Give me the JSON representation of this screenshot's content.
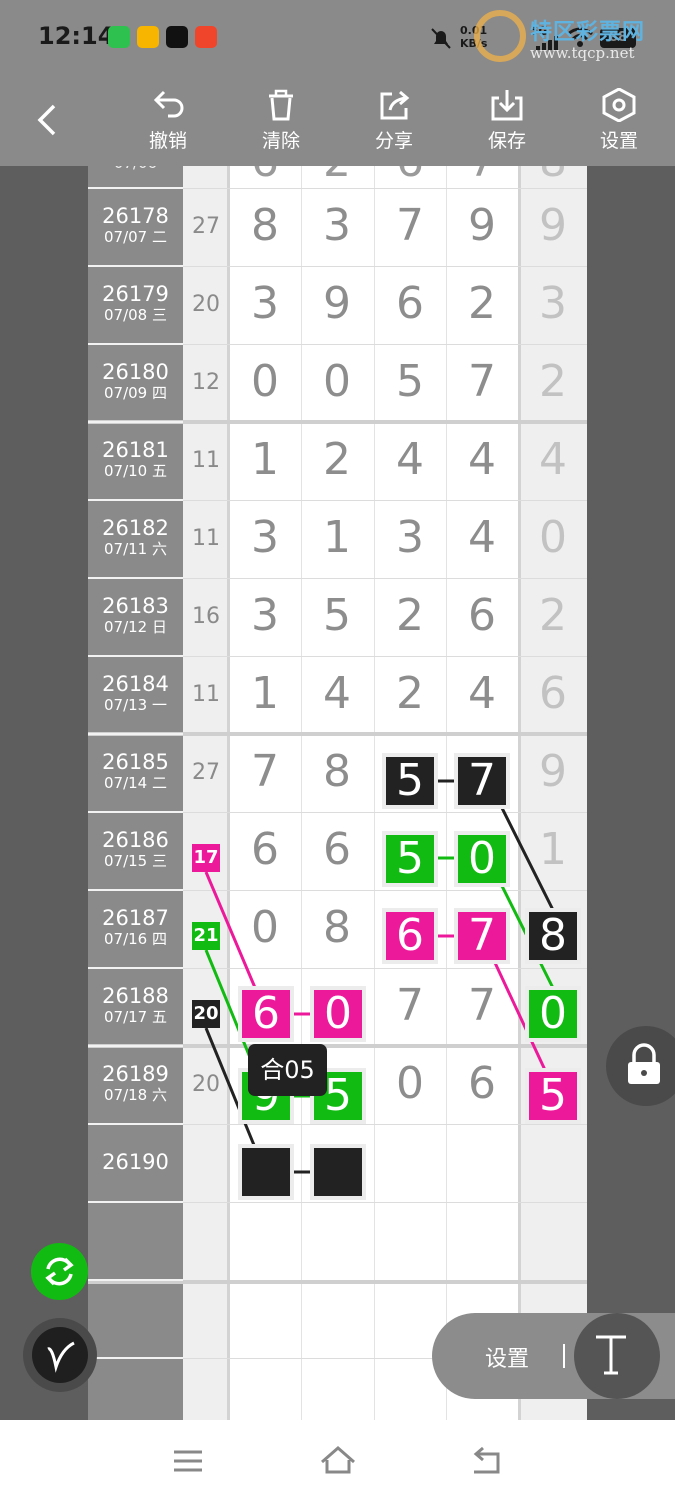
{
  "status_bar": {
    "time": "12:14",
    "net_speed": "0.01\nKB/s",
    "signal": "5G",
    "battery": "88",
    "apps": [
      {
        "name": "wechat-icon",
        "color": "#2fc14f"
      },
      {
        "name": "weibo-icon",
        "color": "#f7b500"
      },
      {
        "name": "tiktok-icon",
        "color": "#111111"
      },
      {
        "name": "app-icon",
        "color": "#f0452a"
      }
    ]
  },
  "watermark": {
    "title": "特区彩票网",
    "url": "www.tqcp.net"
  },
  "toolbar": {
    "back_label": "",
    "undo": "撤销",
    "clear": "清除",
    "share": "分享",
    "save": "保存",
    "settings": "设置"
  },
  "rows": [
    {
      "issue": "26178",
      "date": "07/07 二",
      "sum": "27",
      "digits": [
        "8",
        "3",
        "7",
        "9"
      ],
      "last": "9"
    },
    {
      "issue": "26179",
      "date": "07/08 三",
      "sum": "20",
      "digits": [
        "3",
        "9",
        "6",
        "2"
      ],
      "last": "3"
    },
    {
      "issue": "26180",
      "date": "07/09 四",
      "sum": "12",
      "digits": [
        "0",
        "0",
        "5",
        "7"
      ],
      "last": "2"
    },
    {
      "issue": "26181",
      "date": "07/10 五",
      "sum": "11",
      "digits": [
        "1",
        "2",
        "4",
        "4"
      ],
      "last": "4"
    },
    {
      "issue": "26182",
      "date": "07/11 六",
      "sum": "11",
      "digits": [
        "3",
        "1",
        "3",
        "4"
      ],
      "last": "0"
    },
    {
      "issue": "26183",
      "date": "07/12 日",
      "sum": "16",
      "digits": [
        "3",
        "5",
        "2",
        "6"
      ],
      "last": "2"
    },
    {
      "issue": "26184",
      "date": "07/13 一",
      "sum": "11",
      "digits": [
        "1",
        "4",
        "2",
        "4"
      ],
      "last": "6"
    },
    {
      "issue": "26185",
      "date": "07/14 二",
      "sum": "27",
      "digits": [
        "7",
        "8",
        "5",
        "7"
      ],
      "last": "9"
    },
    {
      "issue": "26186",
      "date": "07/15 三",
      "sum": "17",
      "digits": [
        "6",
        "6",
        "5",
        "0"
      ],
      "last": "1"
    },
    {
      "issue": "26187",
      "date": "07/16 四",
      "sum": "21",
      "digits": [
        "0",
        "8",
        "6",
        "7"
      ],
      "last": "8"
    },
    {
      "issue": "26188",
      "date": "07/17 五",
      "sum": "20",
      "digits": [
        "6",
        "0",
        "7",
        "7"
      ],
      "last": "0"
    },
    {
      "issue": "26189",
      "date": "07/18 六",
      "sum": "20",
      "digits": [
        "9",
        "5",
        "0",
        "6"
      ],
      "last": "5"
    },
    {
      "issue": "26190",
      "date": "",
      "sum": "",
      "digits": [
        "",
        "",
        "",
        ""
      ],
      "last": ""
    }
  ],
  "tooltip": "合05",
  "floating": {
    "settings_label": "设置"
  },
  "colors": {
    "black": "#222222",
    "green": "#12bb12",
    "magenta": "#ec1a9b",
    "gray_text": "#8d8d8d"
  }
}
